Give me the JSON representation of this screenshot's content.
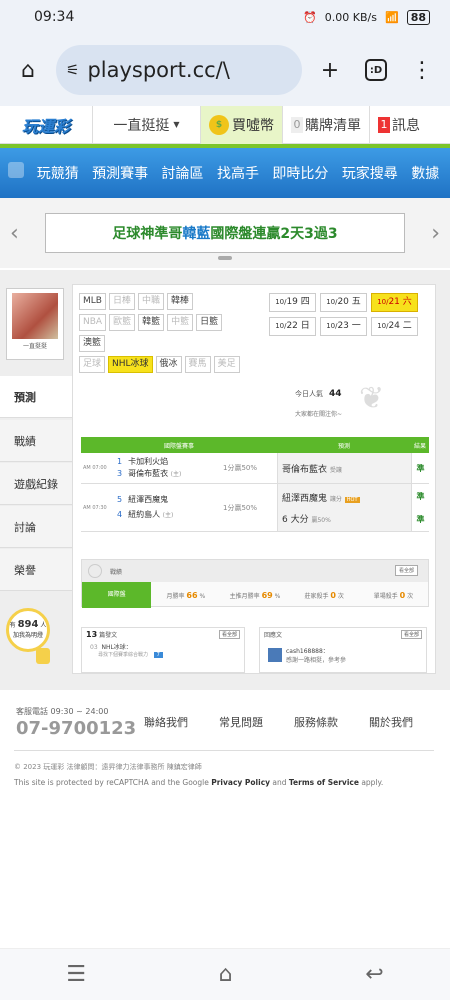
{
  "status_bar": {
    "time": "09:34",
    "net_speed": "0.00 KB/s",
    "battery": "88"
  },
  "browser": {
    "url": "playsport.cc/\\",
    "tab_count": ":D"
  },
  "site": {
    "logo": "玩運彩",
    "top_nav": {
      "dropdown": "一直挺挺",
      "coin": "買噓幣",
      "cart_count": "0",
      "cart": "購牌清單",
      "msg_count": "1",
      "msg": "訊息"
    },
    "main_nav": [
      "玩競猜",
      "預測賽事",
      "討論區",
      "找高手",
      "即時比分",
      "玩家搜尋",
      "數據"
    ],
    "banner": {
      "pre": "足球神準哥 ",
      "highlight": "韓藍",
      "post": " 國際盤連贏2天3過3"
    }
  },
  "profile": {
    "name": "一直挺挺",
    "side_tabs": [
      "預測",
      "戰績",
      "遊戲紀錄",
      "討論",
      "榮譽"
    ],
    "bulb_count": "894",
    "bulb_pre": "有",
    "bulb_unit": "人",
    "bulb_text": "加我為明燈"
  },
  "leagues": {
    "row1": [
      {
        "label": "MLB",
        "state": "normal"
      },
      {
        "label": "日棒",
        "state": "dim"
      },
      {
        "label": "中職",
        "state": "dim"
      },
      {
        "label": "韓棒",
        "state": "normal"
      }
    ],
    "row2": [
      {
        "label": "NBA",
        "state": "dim"
      },
      {
        "label": "歐籃",
        "state": "dim"
      },
      {
        "label": "韓籃",
        "state": "normal"
      },
      {
        "label": "中籃",
        "state": "dim"
      },
      {
        "label": "日籃",
        "state": "normal"
      }
    ],
    "row3": [
      {
        "label": "澳籃",
        "state": "normal"
      }
    ],
    "row4": [
      {
        "label": "足球",
        "state": "dim"
      },
      {
        "label": "NHL冰球",
        "state": "selected"
      },
      {
        "label": "俄冰",
        "state": "normal"
      },
      {
        "label": "賽馬",
        "state": "dim"
      },
      {
        "label": "美足",
        "state": "dim"
      }
    ]
  },
  "dates": [
    {
      "m": "10/",
      "d": "19",
      "w": "四",
      "sel": false
    },
    {
      "m": "10/",
      "d": "20",
      "w": "五",
      "sel": false
    },
    {
      "m": "10/",
      "d": "21",
      "w": "六",
      "sel": true
    },
    {
      "m": "10/",
      "d": "22",
      "w": "日",
      "sel": false
    },
    {
      "m": "10/",
      "d": "23",
      "w": "一",
      "sel": false
    },
    {
      "m": "10/",
      "d": "24",
      "w": "二",
      "sel": false
    }
  ],
  "today": {
    "label": "今日人氣",
    "count": "44",
    "note": "大家都在關注你~"
  },
  "games": {
    "headers": [
      "國際盤賽事",
      "預測",
      "結果"
    ],
    "rows": [
      {
        "time": "AM 07:00",
        "t1_no": "1",
        "t1": "卡加利火焰",
        "t2_no": "3",
        "t2": "哥倫布藍衣",
        "t2_tag": "(主)",
        "spread": "1分贏50%",
        "picks": [
          {
            "text": "哥倫布藍衣",
            "sub": "受讓"
          }
        ],
        "results": [
          "準"
        ]
      },
      {
        "time": "AM 07:30",
        "t1_no": "5",
        "t1": "紐澤西魔鬼",
        "t2_no": "4",
        "t2": "紐約島人",
        "t2_tag": "(主)",
        "spread": "1分贏50%",
        "picks": [
          {
            "text": "紐澤西魔鬼",
            "sub": "讓分"
          },
          {
            "text": "6 大分",
            "sub": "贏50%"
          }
        ],
        "results": [
          "準",
          "準"
        ]
      }
    ]
  },
  "stats": {
    "title": "戰績",
    "see_all": "看全部",
    "items": [
      {
        "label": "國際盤",
        "val": ""
      },
      {
        "label": "月勝率",
        "val": "66"
      },
      {
        "label": "主推月勝率",
        "val": "69"
      },
      {
        "label": "莊家殺手",
        "val": "0"
      },
      {
        "label": "單場殺手",
        "val": "0"
      }
    ]
  },
  "posts": {
    "count": "13",
    "label": "篇發文",
    "see_all": "看全部",
    "item_no": "03",
    "item_title": "NHL冰球：",
    "item_sub": "尋找下個賽季綜合戰力",
    "item_replies": "7"
  },
  "replies": {
    "label": "回應文",
    "see_all": "看全部",
    "user": "cash168888：",
    "text": "感謝一路相挺，參考參"
  },
  "footer": {
    "hotline_label": "客服電話",
    "hotline_hours": "09:30 ~ 24:00",
    "phone": "07-9700123",
    "links": [
      "聯絡我們",
      "常見問題",
      "服務條款",
      "關於我們"
    ],
    "copyright": "© 2023 玩運彩 法律顧問：遠昇律力法律事務所 陳鎮宏律師",
    "recaptcha_pre": "This site is protected by reCAPTCHA and the Google ",
    "privacy": "Privacy Policy",
    "and": " and ",
    "terms": "Terms of Service",
    "recaptcha_post": " apply."
  }
}
